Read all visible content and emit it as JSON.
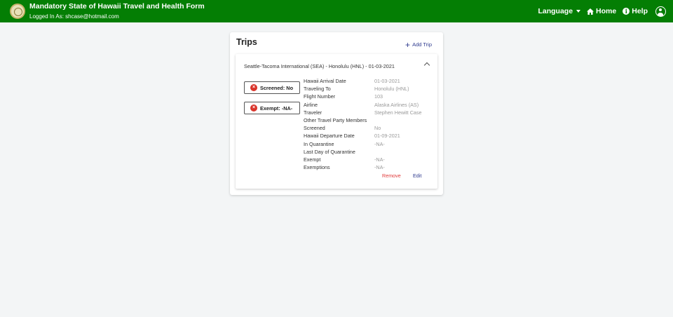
{
  "header": {
    "title": "Mandatory State of Hawaii Travel and Health Form",
    "logged_in": "Logged In As: shcase@hotmail.com",
    "nav": {
      "language": "Language",
      "home": "Home",
      "help": "Help"
    },
    "icons": {
      "seal": "state-seal-logo",
      "home": "home-icon",
      "help": "info-icon",
      "account": "user-circle-icon"
    }
  },
  "trips": {
    "title": "Trips",
    "add_label": "Add Trip",
    "trip": {
      "header": "Seattle-Tacoma International (SEA) - Honolulu (HNL) - 01-03-2021",
      "badges": {
        "screened": "Screened: No",
        "exempt": "Exempt: -NA-"
      },
      "details": [
        {
          "label": "Hawaii Arrival Date",
          "value": "01-03-2021"
        },
        {
          "label": "Traveling To",
          "value": "Honolulu (HNL)"
        },
        {
          "label": "Flight Number",
          "value": "103"
        },
        {
          "label": "Airline",
          "value": "Alaska Airlines (AS)"
        },
        {
          "label": "Traveler",
          "value": "Stephen Hewitt Case"
        },
        {
          "label": "Other Travel Party Members",
          "value": ""
        },
        {
          "label": "Screened",
          "value": "No"
        },
        {
          "label": "Hawaii Departure Date",
          "value": "01-09-2021"
        },
        {
          "label": "In Quarantine",
          "value": "-NA-"
        },
        {
          "label": "Last Day of Quarantine",
          "value": ""
        },
        {
          "label": "Exempt",
          "value": "-NA-"
        },
        {
          "label": "Exemptions",
          "value": "-NA-"
        }
      ],
      "actions": {
        "remove": "Remove",
        "edit": "Edit"
      }
    }
  },
  "colors": {
    "header_bg": "#047e04",
    "page_bg": "#f3f5f6",
    "accent": "#2f3b8f",
    "danger": "#e03a3a"
  }
}
